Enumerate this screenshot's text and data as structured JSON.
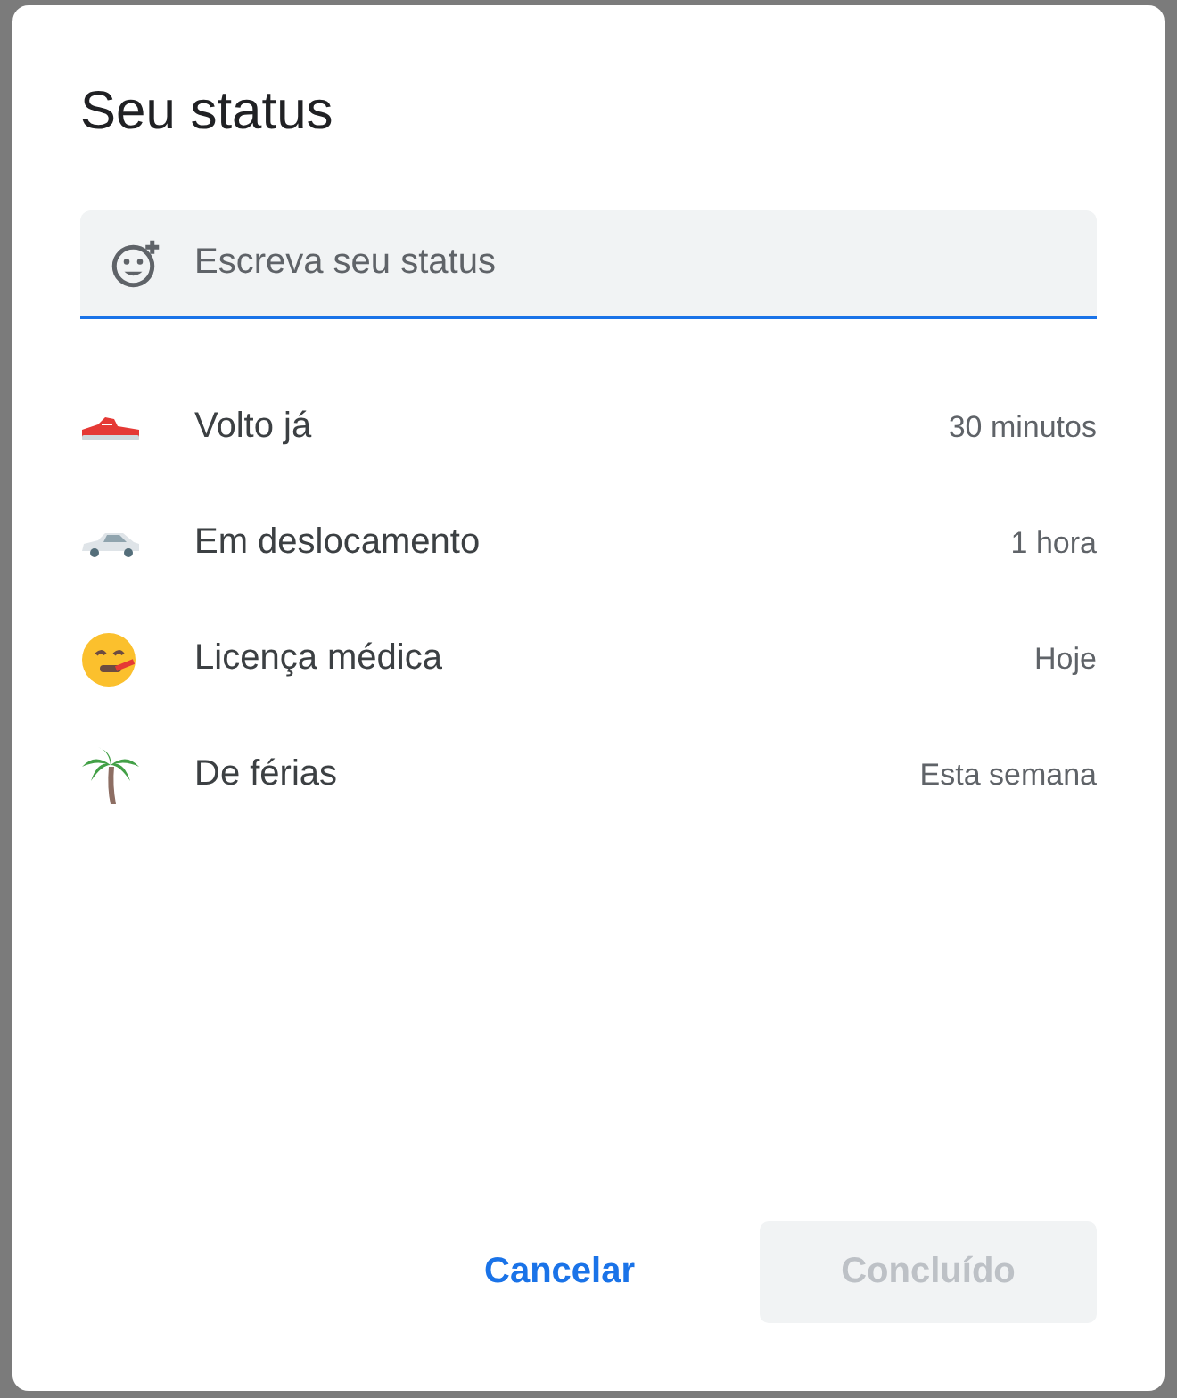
{
  "dialog": {
    "title": "Seu status",
    "status_field": {
      "placeholder": "Escreva seu status"
    },
    "presets": [
      {
        "kind": "sneaker",
        "label": "Volto já",
        "duration": "30 minutos"
      },
      {
        "kind": "car",
        "label": "Em deslocamento",
        "duration": "1 hora"
      },
      {
        "kind": "sick-face",
        "label": "Licença médica",
        "duration": "Hoje"
      },
      {
        "kind": "palm",
        "label": "De férias",
        "duration": "Esta semana"
      }
    ],
    "buttons": [
      {
        "label": "Cancelar",
        "kind": "text",
        "disabled": false
      },
      {
        "label": "Concluído",
        "kind": "filled",
        "disabled": true
      }
    ]
  }
}
